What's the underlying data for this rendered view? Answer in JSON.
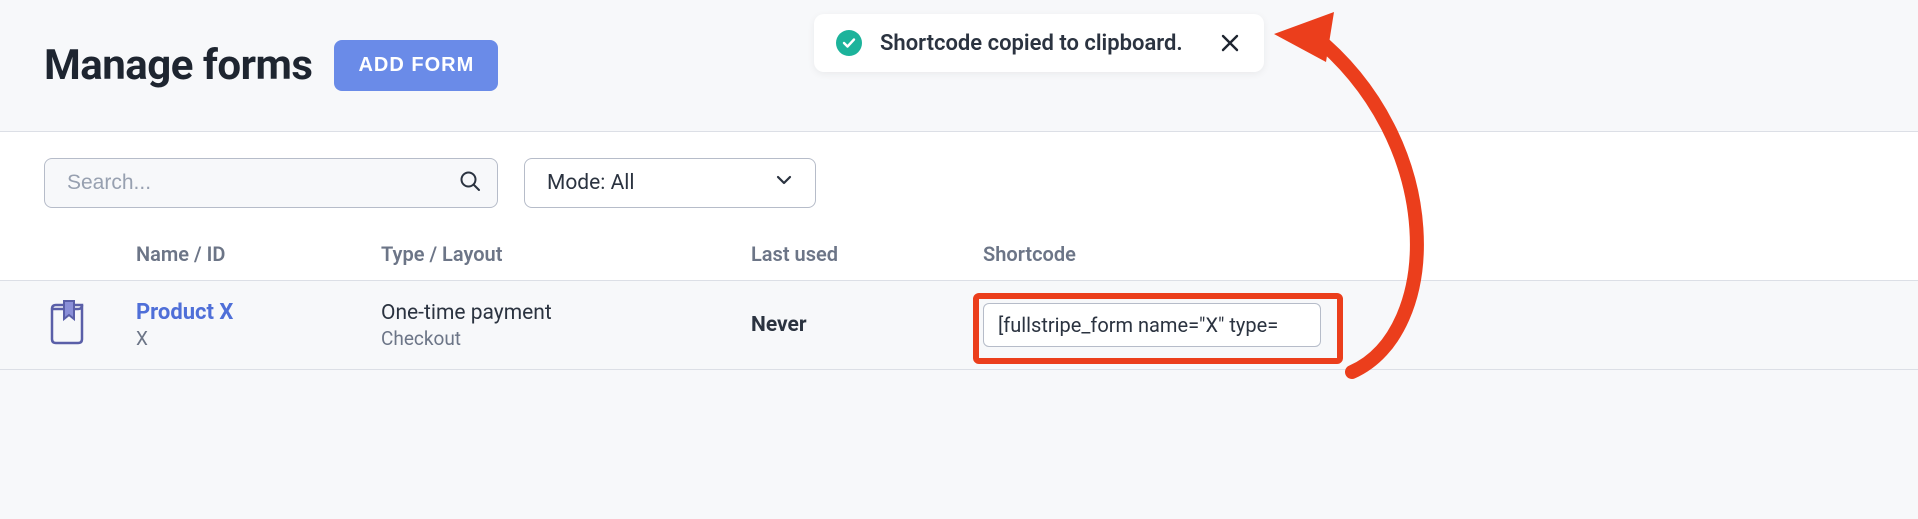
{
  "header": {
    "title": "Manage forms",
    "add_button": "ADD FORM"
  },
  "toast": {
    "message": "Shortcode copied to clipboard."
  },
  "filters": {
    "search_placeholder": "Search...",
    "mode_label": "Mode: All"
  },
  "table": {
    "headers": {
      "name": "Name / ID",
      "type": "Type / Layout",
      "last_used": "Last used",
      "shortcode": "Shortcode"
    },
    "rows": [
      {
        "name": "Product X",
        "id": "X",
        "type": "One-time payment",
        "layout": "Checkout",
        "last_used": "Never",
        "shortcode": "[fullstripe_form name=\"X\" type="
      }
    ]
  },
  "colors": {
    "accent_blue": "#6a8be8",
    "link_blue": "#4f6fd8",
    "toast_green": "#1cb39b",
    "annotation_red": "#eb3e1c"
  }
}
